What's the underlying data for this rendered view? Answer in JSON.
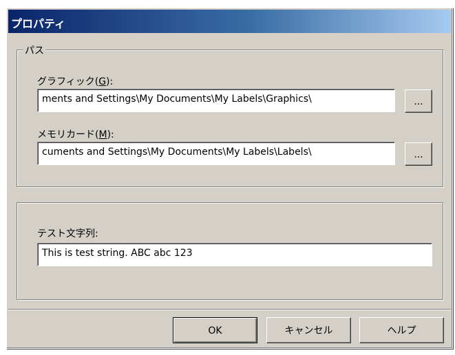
{
  "window": {
    "title": "プロパティ"
  },
  "path_group": {
    "legend": "パス",
    "graphics": {
      "label_text": "グラフィック(",
      "label_mnemonic": "G",
      "label_suffix": "):",
      "value": "ments and Settings\\My Documents\\My Labels\\Graphics\\",
      "browse_label": "..."
    },
    "memory_card": {
      "label_text": "メモリカード(",
      "label_mnemonic": "M",
      "label_suffix": "):",
      "value": "cuments and Settings\\My Documents\\My Labels\\Labels\\",
      "browse_label": "..."
    }
  },
  "test_group": {
    "label": "テスト文字列:",
    "value": "This is test string. ABC abc 123"
  },
  "buttons": {
    "ok": "OK",
    "cancel": "キャンセル",
    "help": "ヘルプ"
  }
}
